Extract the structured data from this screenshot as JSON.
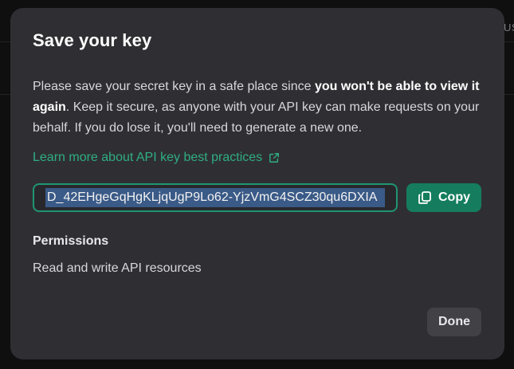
{
  "background": {
    "partial_text": "US"
  },
  "dialog": {
    "title": "Save your key",
    "description": {
      "part1": "Please save your secret key in a safe place since ",
      "bold": "you won't be able to view it again",
      "part2": ". Keep it secure, as anyone with your API key can make requests on your behalf. If you do lose it, you'll need to generate a new one."
    },
    "learn_more_link": "Learn more about API key best practices",
    "link_icon": "external-link-icon",
    "key_value": "D_42EHgeGqHgKLjqUgP9Lo62-YjzVmG4SCZ30qu6DXIA",
    "copy_button": {
      "label": "Copy",
      "icon": "copy-icon"
    },
    "permissions": {
      "label": "Permissions",
      "value": "Read and write API resources"
    },
    "done_button": "Done"
  },
  "colors": {
    "modal_bg": "#2f2f33",
    "accent_green": "#157d5d",
    "link_green": "#2fae82",
    "selection_blue": "#3a5a87"
  }
}
